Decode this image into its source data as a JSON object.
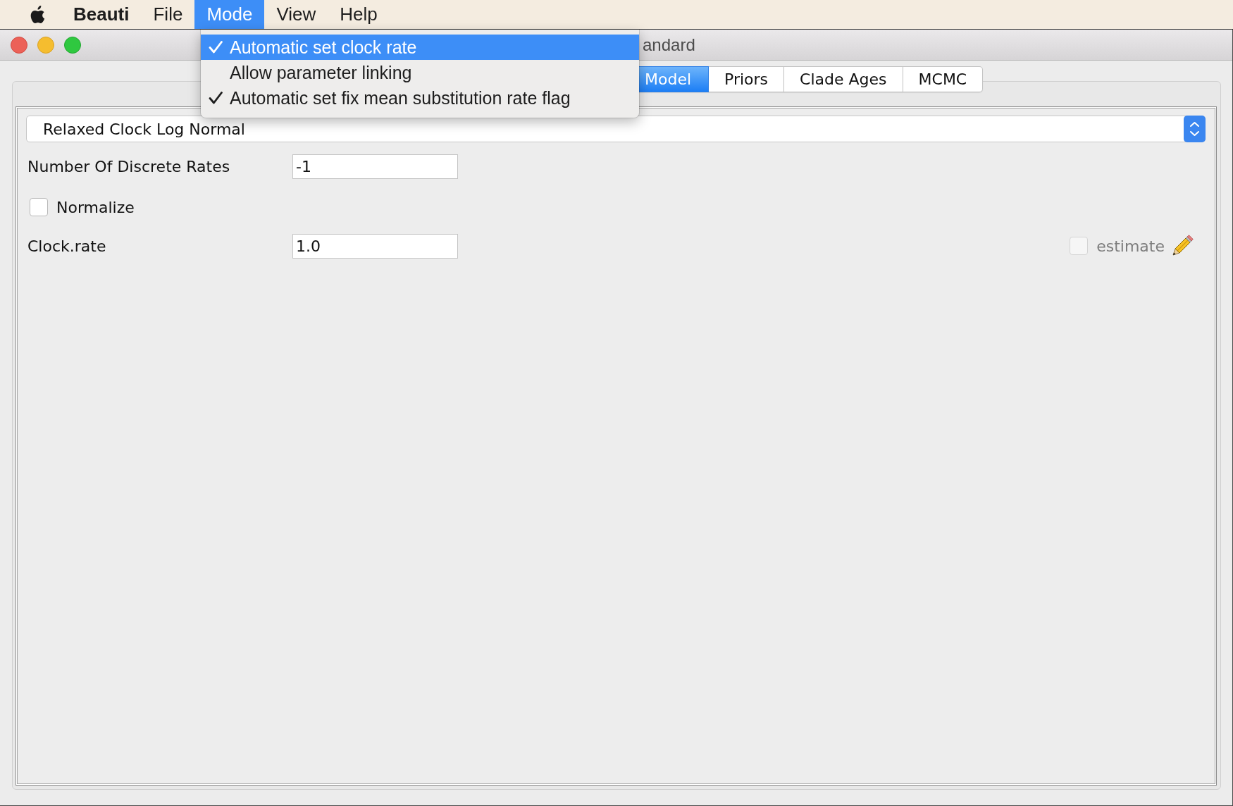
{
  "menu_bar": {
    "app_name": "Beauti",
    "menus": [
      {
        "label": "File",
        "selected": false
      },
      {
        "label": "Mode",
        "selected": true
      },
      {
        "label": "View",
        "selected": false
      },
      {
        "label": "Help",
        "selected": false
      }
    ]
  },
  "window": {
    "title": "andard"
  },
  "tabs": [
    {
      "label": "Model",
      "selected": true
    },
    {
      "label": "Priors",
      "selected": false
    },
    {
      "label": "Clade Ages",
      "selected": false
    },
    {
      "label": "MCMC",
      "selected": false
    }
  ],
  "clock_model": {
    "value": "Relaxed Clock Log Normal"
  },
  "fields": [
    {
      "kind": "text",
      "label": "Number Of Discrete Rates",
      "value": "-1"
    },
    {
      "kind": "checkbox",
      "label": "Normalize",
      "checked": false
    },
    {
      "kind": "parameter",
      "label": "Clock.rate",
      "value": "1.0",
      "estimate": {
        "label": "estimate",
        "checked": false,
        "disabled": true
      }
    }
  ],
  "mode_menu": {
    "items": [
      {
        "label": "Automatic set clock rate",
        "checked": true,
        "selected": true
      },
      {
        "label": "Allow parameter linking",
        "checked": false,
        "selected": false
      },
      {
        "label": "Automatic set fix mean substitution rate flag",
        "checked": true,
        "selected": false
      }
    ]
  }
}
